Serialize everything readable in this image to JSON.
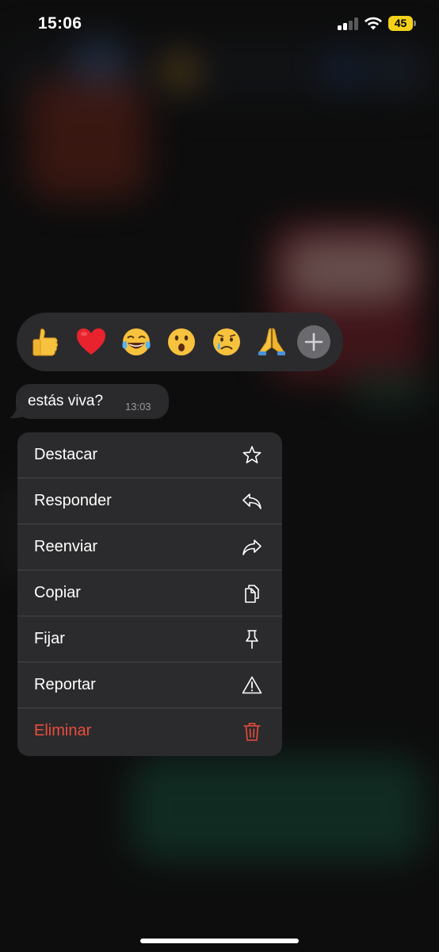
{
  "status_bar": {
    "time": "15:06",
    "battery": "45",
    "signal_bars_active": 2,
    "signal_bars_total": 4,
    "battery_color": "#f5d21a"
  },
  "reactions": [
    {
      "name": "thumbs-up-emoji"
    },
    {
      "name": "red-heart-emoji"
    },
    {
      "name": "tears-of-joy-emoji"
    },
    {
      "name": "surprised-face-emoji"
    },
    {
      "name": "crying-face-emoji"
    },
    {
      "name": "folded-hands-emoji"
    }
  ],
  "message": {
    "text": "estás viva?",
    "time": "13:03"
  },
  "menu": {
    "items": [
      {
        "label": "Destacar",
        "icon": "star-icon"
      },
      {
        "label": "Responder",
        "icon": "reply-icon"
      },
      {
        "label": "Reenviar",
        "icon": "forward-icon"
      },
      {
        "label": "Copiar",
        "icon": "copy-icon"
      },
      {
        "label": "Fijar",
        "icon": "pin-icon"
      },
      {
        "label": "Reportar",
        "icon": "warning-icon"
      },
      {
        "label": "Eliminar",
        "icon": "trash-icon",
        "danger": true
      }
    ],
    "danger_color": "#eb4d3d"
  }
}
